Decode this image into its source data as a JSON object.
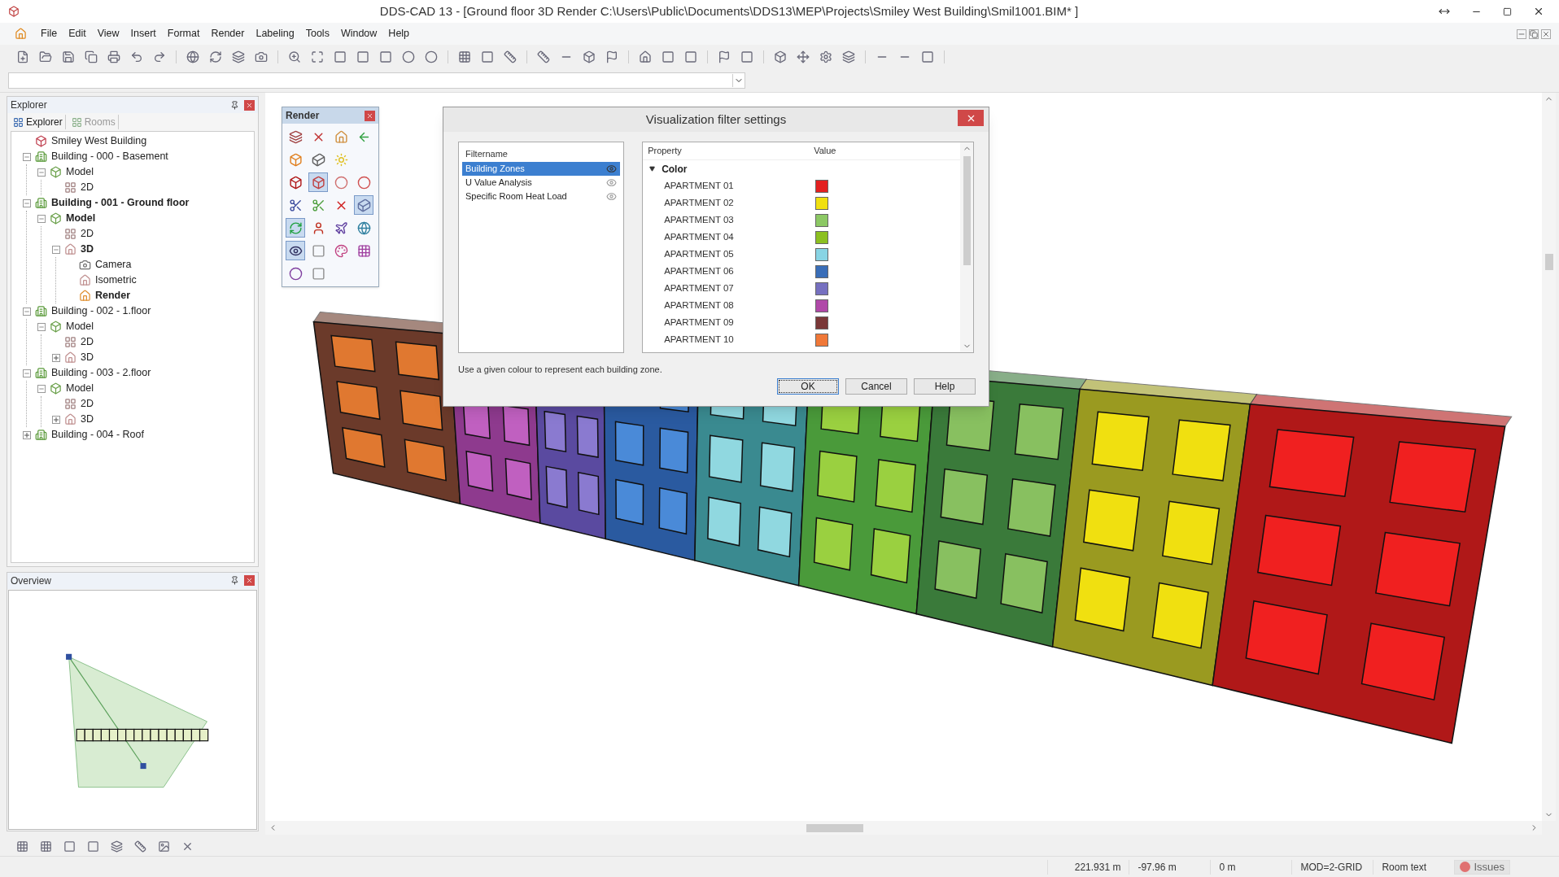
{
  "window": {
    "title": "DDS-CAD 13 - [Ground floor  3D  Render  C:\\Users\\Public\\Documents\\DDS13\\MEP\\Projects\\Smiley West Building\\Smil1001.BIM* ]"
  },
  "menu": [
    "File",
    "Edit",
    "View",
    "Insert",
    "Format",
    "Render",
    "Labeling",
    "Tools",
    "Window",
    "Help"
  ],
  "explorer": {
    "title": "Explorer",
    "tabs": [
      {
        "label": "Explorer",
        "selected": true
      },
      {
        "label": "Rooms",
        "selected": false
      }
    ],
    "tree": [
      {
        "label": "Smiley West Building",
        "kind": "project",
        "active": false
      },
      {
        "label": "Building - 000 - Basement",
        "kind": "building",
        "active": false,
        "expanded": true,
        "children": [
          {
            "label": "Model",
            "kind": "model",
            "active": false,
            "expanded": true,
            "children": [
              {
                "label": "2D",
                "kind": "plan",
                "active": false
              }
            ]
          }
        ]
      },
      {
        "label": "Building - 001 - Ground floor",
        "kind": "building",
        "active": true,
        "expanded": true,
        "children": [
          {
            "label": "Model",
            "kind": "model",
            "active": true,
            "expanded": true,
            "children": [
              {
                "label": "2D",
                "kind": "plan",
                "active": false
              },
              {
                "label": "3D",
                "kind": "view3d",
                "active": true,
                "expanded": true,
                "children": [
                  {
                    "label": "Camera",
                    "kind": "camera",
                    "active": false
                  },
                  {
                    "label": "Isometric",
                    "kind": "view3d",
                    "active": false
                  },
                  {
                    "label": "Render",
                    "kind": "render",
                    "active": true
                  }
                ]
              }
            ]
          }
        ]
      },
      {
        "label": "Building - 002 - 1.floor",
        "kind": "building",
        "active": false,
        "expanded": true,
        "children": [
          {
            "label": "Model",
            "kind": "model",
            "active": false,
            "expanded": true,
            "children": [
              {
                "label": "2D",
                "kind": "plan",
                "active": false
              },
              {
                "label": "3D",
                "kind": "view3d",
                "active": false,
                "expanded": false
              }
            ]
          }
        ]
      },
      {
        "label": "Building - 003 - 2.floor",
        "kind": "building",
        "active": false,
        "expanded": true,
        "children": [
          {
            "label": "Model",
            "kind": "model",
            "active": false,
            "expanded": true,
            "children": [
              {
                "label": "2D",
                "kind": "plan",
                "active": false
              },
              {
                "label": "3D",
                "kind": "view3d",
                "active": false,
                "expanded": false
              }
            ]
          }
        ]
      },
      {
        "label": "Building - 004 - Roof",
        "kind": "building",
        "active": false,
        "expanded": false
      }
    ]
  },
  "overview": {
    "title": "Overview"
  },
  "render_palette": {
    "title": "Render",
    "rows": [
      [
        {
          "selected": false
        },
        {
          "selected": false
        },
        {
          "selected": false
        },
        {
          "selected": false
        }
      ],
      [
        {
          "selected": false
        },
        {
          "selected": false
        },
        {
          "selected": false
        }
      ],
      [
        {
          "selected": false
        },
        {
          "selected": true
        },
        {
          "selected": false
        },
        {
          "selected": false
        }
      ],
      [
        {
          "selected": false
        },
        {
          "selected": false
        },
        {
          "selected": false
        },
        {
          "selected": true
        }
      ],
      [
        {
          "selected": true
        },
        {
          "selected": false
        },
        {
          "selected": false
        },
        {
          "selected": false
        }
      ],
      [
        {
          "selected": true
        },
        {
          "selected": false
        },
        {
          "selected": false
        },
        {
          "selected": false
        }
      ],
      [
        {
          "selected": false
        },
        {
          "selected": false
        }
      ]
    ]
  },
  "dialog": {
    "title": "Visualization filter settings",
    "filters": {
      "header": "Filtername",
      "items": [
        {
          "label": "Building Zones",
          "selected": true
        },
        {
          "label": "U Value Analysis",
          "selected": false
        },
        {
          "label": "Specific Room Heat Load",
          "selected": false
        }
      ]
    },
    "properties": {
      "columns": [
        "Property",
        "Value"
      ],
      "group": {
        "label": "Color",
        "expanded": true
      },
      "rows": [
        {
          "name": "APARTMENT 01",
          "color": "#e32020"
        },
        {
          "name": "APARTMENT 02",
          "color": "#f0e010"
        },
        {
          "name": "APARTMENT 03",
          "color": "#8cc864"
        },
        {
          "name": "APARTMENT 04",
          "color": "#8cc020"
        },
        {
          "name": "APARTMENT 05",
          "color": "#88d4e4"
        },
        {
          "name": "APARTMENT 06",
          "color": "#3a6eb8"
        },
        {
          "name": "APARTMENT 07",
          "color": "#7670c0"
        },
        {
          "name": "APARTMENT 08",
          "color": "#b048a8"
        },
        {
          "name": "APARTMENT 09",
          "color": "#7a3838"
        },
        {
          "name": "APARTMENT 10",
          "color": "#f07838"
        }
      ]
    },
    "description": "Use a given colour to represent each building zone.",
    "buttons": [
      {
        "label": "OK",
        "default": true
      },
      {
        "label": "Cancel",
        "default": false
      },
      {
        "label": "Help",
        "default": false
      }
    ]
  },
  "status_bar": {
    "fields": [
      "221.931 m",
      "-97.96 m",
      "0 m",
      "MOD=2-GRID",
      "Room text"
    ],
    "issues": "Issues"
  }
}
